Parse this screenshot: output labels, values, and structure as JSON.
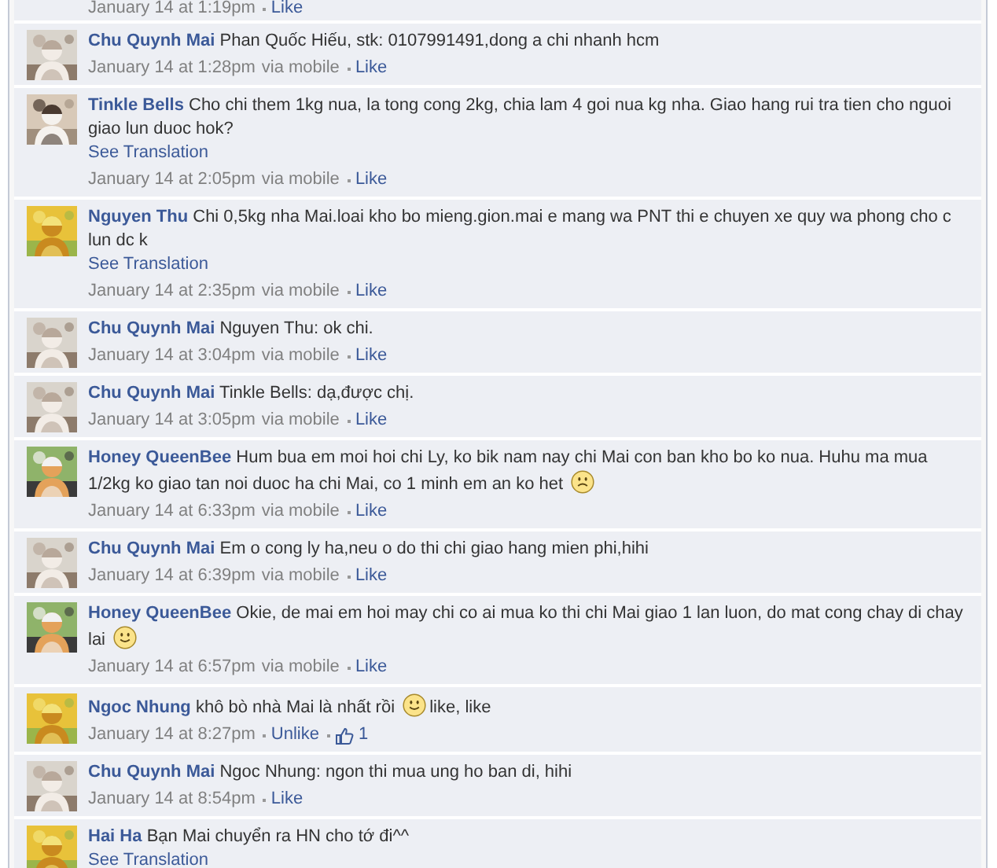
{
  "comments": [
    {
      "time": "January 14 at 1:19pm",
      "actions": [
        {
          "kind": "link",
          "text": "Like"
        }
      ]
    },
    {
      "author": "Chu Quynh Mai",
      "avatar": {
        "kind": "picture"
      },
      "body": [
        {
          "kind": "text",
          "text": "Phan Quốc Hiếu, stk: 0107991491,dong a chi nhanh hcm"
        }
      ],
      "time": "January 14 at 1:28pm",
      "via": "via mobile",
      "actions": [
        {
          "kind": "link",
          "text": "Like"
        }
      ]
    },
    {
      "author": "Tinkle Bells",
      "avatar": {
        "kind": "picture"
      },
      "body": [
        {
          "kind": "text",
          "text": "Cho chi them 1kg nua, la tong cong 2kg, chia lam 4 goi nua kg nha. Giao hang rui tra tien cho nguoi giao lun duoc hok?"
        }
      ],
      "translation": "See Translation",
      "time": "January 14 at 2:05pm",
      "via": "via mobile",
      "actions": [
        {
          "kind": "link",
          "text": "Like"
        }
      ]
    },
    {
      "author": "Nguyen Thu",
      "avatar": {
        "kind": "picture"
      },
      "body": [
        {
          "kind": "text",
          "text": "Chi 0,5kg nha Mai.loai kho bo mieng.gion.mai e mang wa PNT thi e chuyen xe quy wa phong cho c lun dc k"
        }
      ],
      "translation": "See Translation",
      "time": "January 14 at 2:35pm",
      "via": "via mobile",
      "actions": [
        {
          "kind": "link",
          "text": "Like"
        }
      ]
    },
    {
      "author": "Chu Quynh Mai",
      "avatar": {
        "kind": "picture"
      },
      "body": [
        {
          "kind": "text",
          "text": "Nguyen Thu: ok chi."
        }
      ],
      "time": "January 14 at 3:04pm",
      "via": "via mobile",
      "actions": [
        {
          "kind": "link",
          "text": "Like"
        }
      ]
    },
    {
      "author": "Chu Quynh Mai",
      "avatar": {
        "kind": "picture"
      },
      "body": [
        {
          "kind": "text",
          "text": "Tinkle Bells: dạ,được chị."
        }
      ],
      "time": "January 14 at 3:05pm",
      "via": "via mobile",
      "actions": [
        {
          "kind": "link",
          "text": "Like"
        }
      ]
    },
    {
      "author": "Honey QueenBee",
      "avatar": {
        "kind": "picture"
      },
      "body": [
        {
          "kind": "text",
          "text": "Hum bua em moi hoi chi Ly, ko bik nam nay chi Mai con ban kho bo ko nua. Huhu ma mua 1/2kg ko giao tan noi duoc ha chi Mai, co 1 minh em an ko het"
        },
        {
          "kind": "frown"
        }
      ],
      "time": "January 14 at 6:33pm",
      "via": "via mobile",
      "actions": [
        {
          "kind": "link",
          "text": "Like"
        }
      ]
    },
    {
      "author": "Chu Quynh Mai",
      "avatar": {
        "kind": "picture"
      },
      "body": [
        {
          "kind": "text",
          "text": "Em o cong ly ha,neu o do thi chi giao hang mien phi,hihi"
        }
      ],
      "time": "January 14 at 6:39pm",
      "via": "via mobile",
      "actions": [
        {
          "kind": "link",
          "text": "Like"
        }
      ]
    },
    {
      "author": "Honey QueenBee",
      "avatar": {
        "kind": "picture"
      },
      "body": [
        {
          "kind": "text",
          "text": "Okie, de mai em hoi may chi co ai mua ko thi chi Mai giao 1 lan luon, do mat cong chay di chay lai"
        },
        {
          "kind": "smile"
        }
      ],
      "time": "January 14 at 6:57pm",
      "via": "via mobile",
      "actions": [
        {
          "kind": "link",
          "text": "Like"
        }
      ]
    },
    {
      "author": "Ngoc Nhung",
      "avatar": {
        "kind": "picture"
      },
      "body": [
        {
          "kind": "text",
          "text": "khô bò nhà Mai là nhất rồi"
        },
        {
          "kind": "smile"
        },
        {
          "kind": "text",
          "text": "like, like"
        }
      ],
      "time": "January 14 at 8:27pm",
      "actions": [
        {
          "kind": "link",
          "text": "Unlike"
        },
        {
          "kind": "likes",
          "text": "1"
        }
      ]
    },
    {
      "author": "Chu Quynh Mai",
      "avatar": {
        "kind": "picture"
      },
      "body": [
        {
          "kind": "text",
          "text": "Ngoc Nhung: ngon thi mua ung ho ban di, hihi"
        }
      ],
      "time": "January 14 at 8:54pm",
      "actions": [
        {
          "kind": "link",
          "text": "Like"
        }
      ]
    },
    {
      "author": "Hai Ha",
      "avatar": {
        "kind": "picture"
      },
      "body": [
        {
          "kind": "text",
          "text": "Bạn Mai chuyển ra HN cho tớ đi^^"
        }
      ],
      "translation": "See Translation"
    }
  ]
}
